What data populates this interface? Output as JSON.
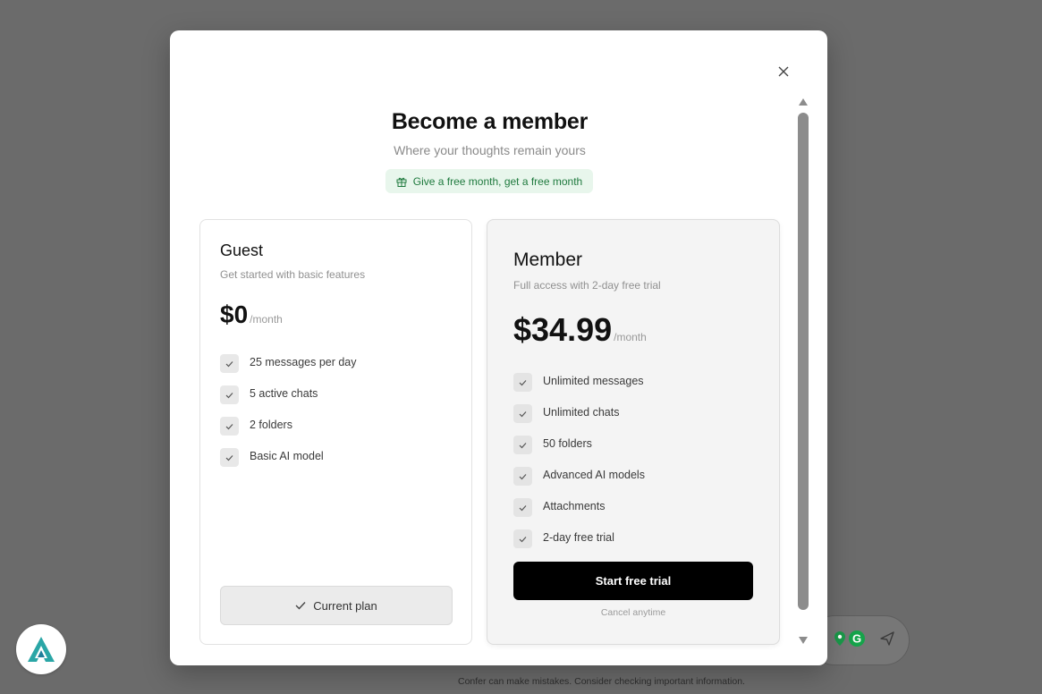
{
  "modal": {
    "title": "Become a member",
    "subtitle": "Where your thoughts remain yours",
    "promo_label": "Give a free month, get a free month"
  },
  "plans": {
    "guest": {
      "name": "Guest",
      "description": "Get started with basic features",
      "price": "$0",
      "period": "/month",
      "features": [
        "25 messages per day",
        "5 active chats",
        "2 folders",
        "Basic AI model"
      ],
      "button_label": "Current plan"
    },
    "member": {
      "name": "Member",
      "description": "Full access with 2-day free trial",
      "price": "$34.99",
      "period": "/month",
      "features": [
        "Unlimited messages",
        "Unlimited chats",
        "50 folders",
        "Advanced AI models",
        "Attachments",
        "2-day free trial"
      ],
      "button_label": "Start free trial",
      "note": "Cancel anytime"
    }
  },
  "background": {
    "footer_note": "Confer can make mistakes. Consider checking important information."
  },
  "icons": {
    "close": "close-icon",
    "gift": "gift-icon",
    "check": "check-icon",
    "send": "send-icon",
    "logo": "app-logo"
  },
  "colors": {
    "accent_black": "#000000",
    "promo_green": "#1f7a3e",
    "promo_bg": "#e8f6ec",
    "overlay": "#6b6b6b"
  }
}
